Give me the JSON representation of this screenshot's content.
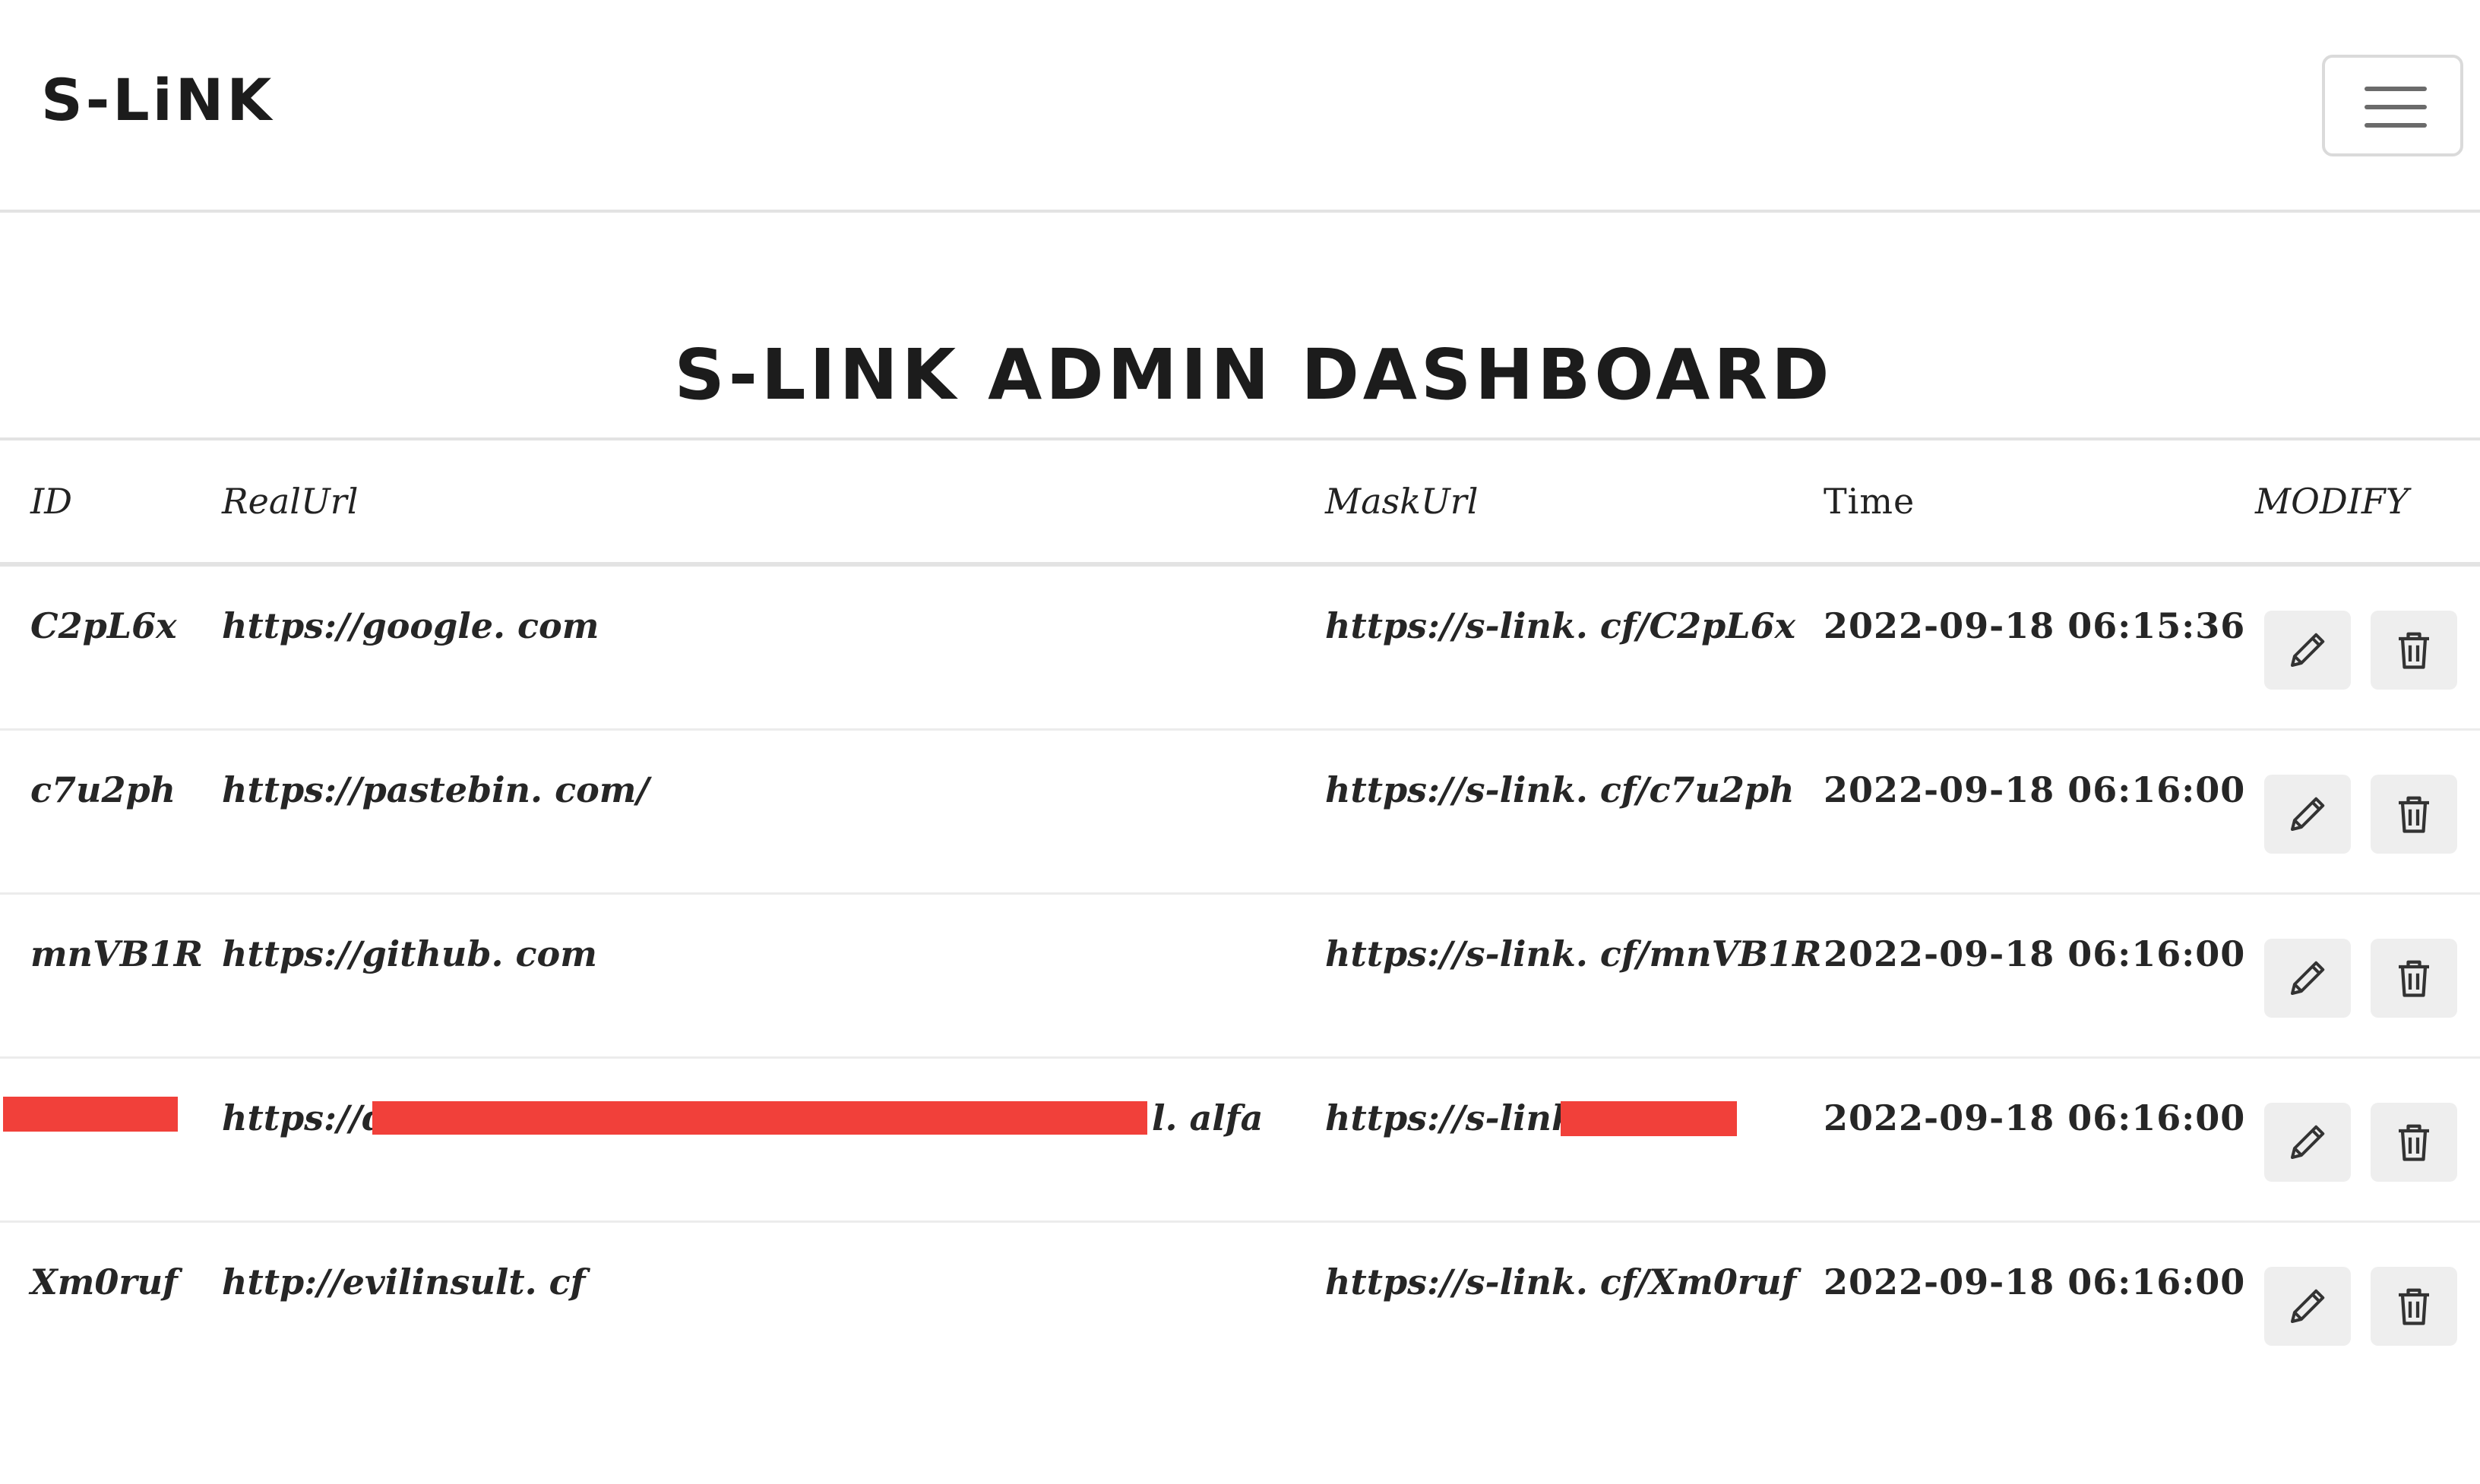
{
  "navbar": {
    "brand": "S-LiNK",
    "menu_icon": "hamburger-menu-icon"
  },
  "page_title": "S-LINK ADMIN DASHBOARD",
  "table": {
    "headers": {
      "id": "ID",
      "real_url": "RealUrl",
      "mask_url": "MaskUrl",
      "time": "Time",
      "modify": "MODIFY"
    },
    "rows": [
      {
        "id": "C2pL6x",
        "real_url": "https://google. com",
        "mask_url": "https://s-link. cf/C2pL6x",
        "time": "2022-09-18 06:15:36"
      },
      {
        "id": "c7u2ph",
        "real_url": "https://pastebin. com/",
        "mask_url": "https://s-link. cf/c7u2ph",
        "time": "2022-09-18 06:16:00"
      },
      {
        "id": "mnVB1R",
        "real_url": "https://github. com",
        "mask_url": "https://s-link. cf/mnVB1R",
        "time": "2022-09-18 06:16:00"
      },
      {
        "id": "",
        "real_url": "https://d",
        "real_url_tail": "l. alfa",
        "mask_url": "https://s-link.",
        "time": "2022-09-18 06:16:00"
      },
      {
        "id": "Xm0ruf",
        "real_url": "http://evilinsult. cf",
        "mask_url": "https://s-link. cf/Xm0ruf",
        "time": "2022-09-18 06:16:00"
      }
    ],
    "row_actions": {
      "edit_icon": "pencil-icon",
      "delete_icon": "trash-icon"
    },
    "redaction_color": "#f1403a"
  }
}
